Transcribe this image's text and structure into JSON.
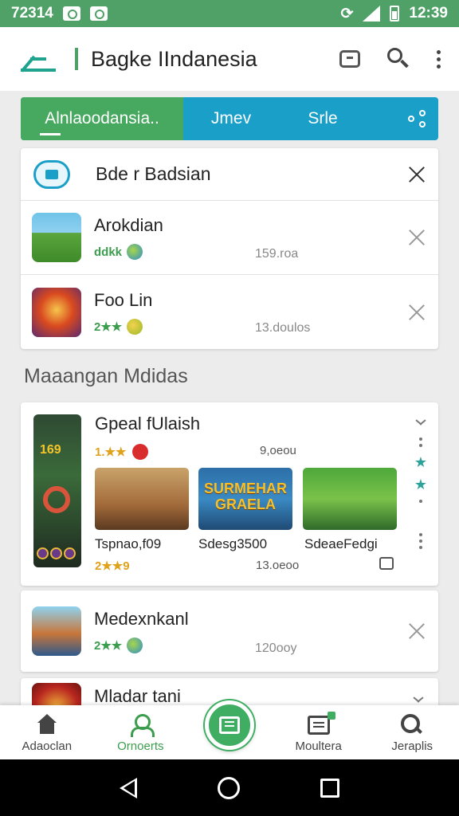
{
  "status_bar": {
    "time_left": "72314",
    "time_right": "12:39"
  },
  "app_bar": {
    "title": "Bagke IIndanesia"
  },
  "tabs": [
    {
      "label": "Alnlaoodansia.."
    },
    {
      "label": "Jmev"
    },
    {
      "label": "Srle"
    }
  ],
  "list_card": {
    "header_title": "Bde r Badsian",
    "items": [
      {
        "name": "Arokdian",
        "rating": "ddkk",
        "size": "159.roa"
      },
      {
        "name": "Foo Lin",
        "rating": "2★★",
        "size": "13.doulos"
      }
    ]
  },
  "section_title": "Maaangan Mdidas",
  "featured": {
    "name": "Gpeal fUlaish",
    "rating": "1.★★",
    "size": "9,oeou",
    "tall_number": "169",
    "screenshots": [
      {
        "overlay": "",
        "label": "Tspnao,f09",
        "sub": "2★★9"
      },
      {
        "overlay": "SURMEHAR GRAELA",
        "label": "Sdesg3500",
        "sub": "13.oeoo"
      },
      {
        "overlay": "",
        "label": "SdeaeFedgi",
        "sub": ""
      }
    ]
  },
  "list_items_2": [
    {
      "name": "Medexnkanl",
      "rating": "2★★",
      "size": "120ooy"
    },
    {
      "name": "Mladar tani",
      "rating": "",
      "size": ""
    }
  ],
  "bottom_nav": [
    {
      "label": "Adaoclan",
      "icon": "home-icon"
    },
    {
      "label": "Ornoerts",
      "icon": "person-icon"
    },
    {
      "label": "Moultera",
      "icon": "document-icon"
    },
    {
      "label": "Jeraplis",
      "icon": "search-icon"
    }
  ],
  "colors": {
    "accent_green": "#47a95f",
    "accent_blue": "#1a9fc9",
    "status_bar": "#4fa167"
  }
}
